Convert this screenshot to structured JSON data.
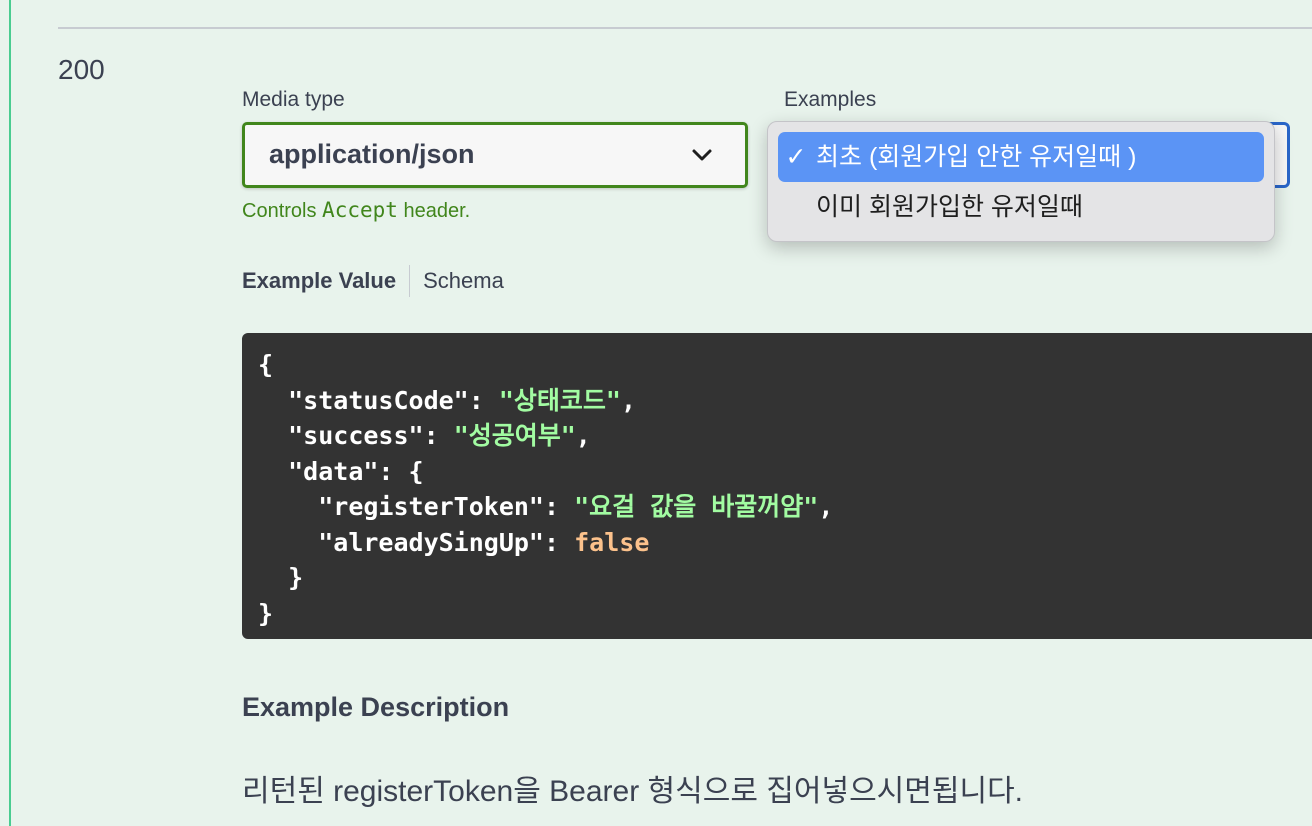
{
  "response": {
    "status_code": "200"
  },
  "media_type": {
    "label": "Media type",
    "selected": "application/json",
    "note_prefix": "Controls",
    "note_code": "Accept",
    "note_suffix": "header."
  },
  "examples": {
    "label": "Examples",
    "options": [
      {
        "check": "✓",
        "label": "최초 (회원가입 안한 유저일때 )",
        "selected": true
      },
      {
        "check": "",
        "label": "이미 회원가입한 유저일때",
        "selected": false
      }
    ]
  },
  "tabs": {
    "example_value": "Example Value",
    "schema": "Schema"
  },
  "code": {
    "open": "{",
    "status_key": "\"statusCode\"",
    "status_val": "\"상태코드\"",
    "success_key": "\"success\"",
    "success_val": "\"성공여부\"",
    "data_key": "\"data\"",
    "register_key": "\"registerToken\"",
    "register_val": "\"요걸 값을 바꿀꺼얌\"",
    "already_key": "\"alreadySingUp\"",
    "already_val": "false",
    "inner_close": "}",
    "close": "}"
  },
  "description": {
    "heading": "Example Description",
    "text": "리턴된 registerToken을 Bearer 형식으로 집어넣으시면됩니다."
  },
  "colors": {
    "accent_green": "#41861c",
    "method_green": "#49cc90",
    "select_blue": "#2a66c9",
    "highlight_blue": "#5b94f5",
    "code_bg": "#333333",
    "code_string": "#a2fca2",
    "code_bool": "#fcc28c"
  },
  "icons": {
    "media_select_arrow": "chevron-down-icon",
    "selected_option_mark": "checkmark-icon"
  }
}
